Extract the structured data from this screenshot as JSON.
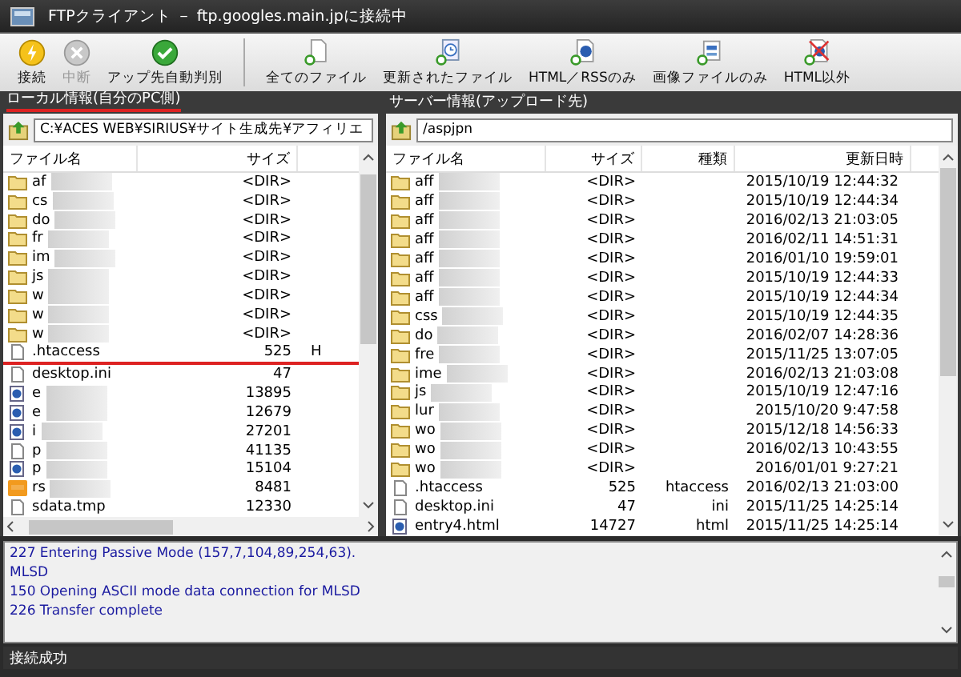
{
  "window": {
    "title": "FTPクライアント － ftp.googles.main.jpに接続中"
  },
  "toolbar": [
    {
      "label": "接続",
      "kind": "connect",
      "disabled": false
    },
    {
      "label": "中断",
      "kind": "abort",
      "disabled": true
    },
    {
      "label": "アップ先自動判別",
      "kind": "auto",
      "disabled": false
    },
    {
      "label": "全てのファイル",
      "kind": "all",
      "disabled": false
    },
    {
      "label": "更新されたファイル",
      "kind": "updated",
      "disabled": false
    },
    {
      "label": "HTML／RSSのみ",
      "kind": "html",
      "disabled": false
    },
    {
      "label": "画像ファイルのみ",
      "kind": "image",
      "disabled": false
    },
    {
      "label": "HTML以外",
      "kind": "nonhtml",
      "disabled": false
    }
  ],
  "local": {
    "header": "ローカル情報(自分のPC側)",
    "header_marked": true,
    "path": "C:¥ACES WEB¥SIRIUS¥サイト生成先¥アフィリエ",
    "columns": [
      "ファイル名",
      "サイズ"
    ],
    "rows": [
      {
        "name": "af",
        "size": "<DIR>",
        "kind": "folder",
        "marked": false
      },
      {
        "name": "cs",
        "size": "<DIR>",
        "kind": "folder",
        "marked": false
      },
      {
        "name": "do",
        "size": "<DIR>",
        "kind": "folder",
        "marked": false
      },
      {
        "name": "fr",
        "size": "<DIR>",
        "kind": "folder",
        "marked": false
      },
      {
        "name": "im",
        "size": "<DIR>",
        "kind": "folder",
        "marked": false
      },
      {
        "name": "js",
        "size": "<DIR>",
        "kind": "folder",
        "marked": false
      },
      {
        "name": "w",
        "size": "<DIR>",
        "kind": "folder",
        "marked": false
      },
      {
        "name": "w",
        "size": "<DIR>",
        "kind": "folder",
        "marked": false
      },
      {
        "name": "w",
        "size": "<DIR>",
        "kind": "folder",
        "marked": false
      },
      {
        "name": ".htaccess",
        "size": "525",
        "column_3": "H",
        "kind": "file",
        "marked": true
      },
      {
        "name": "desktop.ini",
        "size": "47",
        "kind": "file",
        "marked": false
      },
      {
        "name": "e",
        "size": "13895",
        "kind": "html",
        "marked": false
      },
      {
        "name": "e",
        "size": "12679",
        "kind": "html",
        "marked": false
      },
      {
        "name": "i",
        "size": "27201",
        "kind": "html",
        "marked": false
      },
      {
        "name": "p",
        "size": "41135",
        "kind": "file",
        "marked": false
      },
      {
        "name": "p",
        "size": "15104",
        "kind": "html",
        "marked": false
      },
      {
        "name": "rs",
        "size": "8481",
        "kind": "rss",
        "marked": false
      },
      {
        "name": "sdata.tmp",
        "size": "12330",
        "kind": "file",
        "marked": false
      }
    ]
  },
  "server": {
    "header": "サーバー情報(アップロード先)",
    "path": "/aspjpn",
    "columns": [
      "ファイル名",
      "サイズ",
      "種類",
      "更新日時"
    ],
    "rows": [
      {
        "name": "aff",
        "size": "<DIR>",
        "date": "2015/10/19 12:44:32",
        "kind": "folder"
      },
      {
        "name": "aff",
        "size": "<DIR>",
        "date": "2015/10/19 12:44:34",
        "kind": "folder"
      },
      {
        "name": "aff",
        "size": "<DIR>",
        "date": "2016/02/13 21:03:05",
        "kind": "folder"
      },
      {
        "name": "aff",
        "size": "<DIR>",
        "date": "2016/02/11 14:51:31",
        "kind": "folder"
      },
      {
        "name": "aff",
        "size": "<DIR>",
        "date": "2016/01/10 19:59:01",
        "kind": "folder"
      },
      {
        "name": "aff",
        "size": "<DIR>",
        "date": "2015/10/19 12:44:33",
        "kind": "folder"
      },
      {
        "name": "aff",
        "size": "<DIR>",
        "date": "2015/10/19 12:44:34",
        "kind": "folder"
      },
      {
        "name": "css",
        "size": "<DIR>",
        "date": "2015/10/19 12:44:35",
        "kind": "folder"
      },
      {
        "name": "do",
        "size": "<DIR>",
        "date": "2016/02/07 14:28:36",
        "kind": "folder"
      },
      {
        "name": "fre",
        "size": "<DIR>",
        "date": "2015/11/25 13:07:05",
        "kind": "folder"
      },
      {
        "name": "ime",
        "size": "<DIR>",
        "date": "2016/02/13 21:03:08",
        "kind": "folder"
      },
      {
        "name": "js",
        "size": "<DIR>",
        "date": "2015/10/19 12:47:16",
        "kind": "folder"
      },
      {
        "name": "lur",
        "size": "<DIR>",
        "date": "2015/10/20 9:47:58",
        "kind": "folder"
      },
      {
        "name": "wo",
        "size": "<DIR>",
        "date": "2015/12/18 14:56:33",
        "kind": "folder"
      },
      {
        "name": "wo",
        "size": "<DIR>",
        "date": "2016/02/13 10:43:55",
        "kind": "folder"
      },
      {
        "name": "wo",
        "size": "<DIR>",
        "date": "2016/01/01 9:27:21",
        "kind": "folder"
      },
      {
        "name": ".htaccess",
        "size": "525",
        "type": "htaccess",
        "date": "2016/02/13 21:03:00",
        "kind": "file"
      },
      {
        "name": "desktop.ini",
        "size": "47",
        "type": "ini",
        "date": "2015/11/25 14:25:14",
        "kind": "file"
      },
      {
        "name": "entry4.html",
        "size": "14727",
        "type": "html",
        "date": "2015/11/25 14:25:14",
        "kind": "html"
      }
    ]
  },
  "log": [
    "227 Entering Passive Mode (157,7,104,89,254,63).",
    "MLSD",
    "150 Opening ASCII mode data connection for MLSD",
    "226 Transfer complete"
  ],
  "status_bar": "接続成功"
}
